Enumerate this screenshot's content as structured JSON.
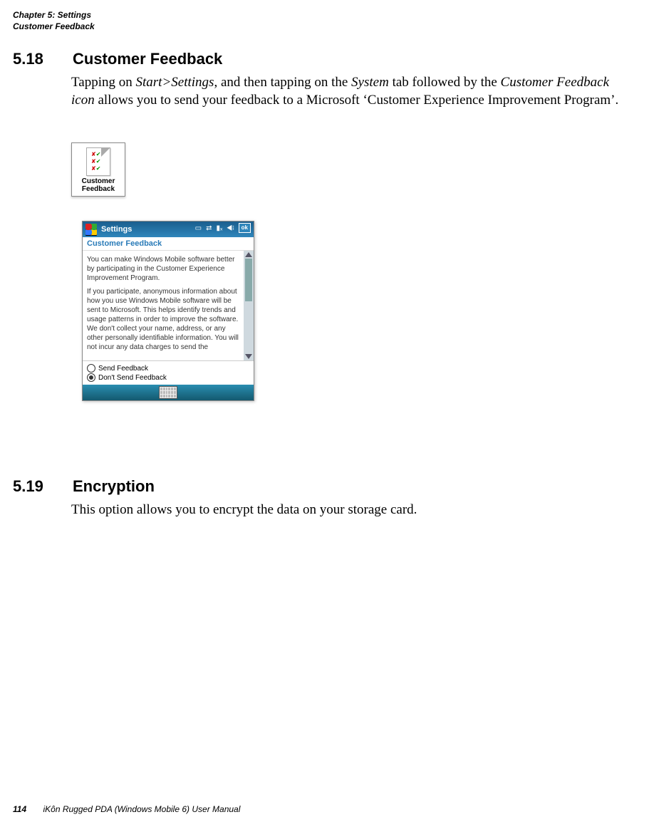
{
  "header": {
    "chapter": "Chapter 5:  Settings",
    "section": "Customer Feedback"
  },
  "sec518": {
    "num": "5.18",
    "title": "Customer Feedback",
    "lead": "Tapping on ",
    "i1": "Start>Settings",
    "mid1": ", and then tapping on the ",
    "i2": "System",
    "mid2": " tab followed by the ",
    "i3": "Customer Feedback icon",
    "tail": " allows you to send your feedback to a Microsoft ‘Customer Experience Improvement Program’."
  },
  "icon": {
    "label1": "Customer",
    "label2": "Feedback"
  },
  "wm": {
    "title": "Settings",
    "ok": "ok",
    "sub": "Customer Feedback",
    "p1": "You can make Windows Mobile software better by participating in the Customer Experience Improvement Program.",
    "p2": "If you participate, anonymous information about how you use Windows Mobile software will be sent to Microsoft. This helps identify trends and usage patterns in order to improve the software. We don't collect your name, address, or any other personally identifiable information. You will not incur any data charges to send the",
    "opt1": "Send Feedback",
    "opt2": "Don't Send Feedback"
  },
  "sec519": {
    "num": "5.19",
    "title": "Encryption",
    "body": "This option allows you to encrypt the data on your storage card."
  },
  "footer": {
    "page": "114",
    "book": "iKôn Rugged PDA (Windows Mobile 6) User Manual"
  }
}
